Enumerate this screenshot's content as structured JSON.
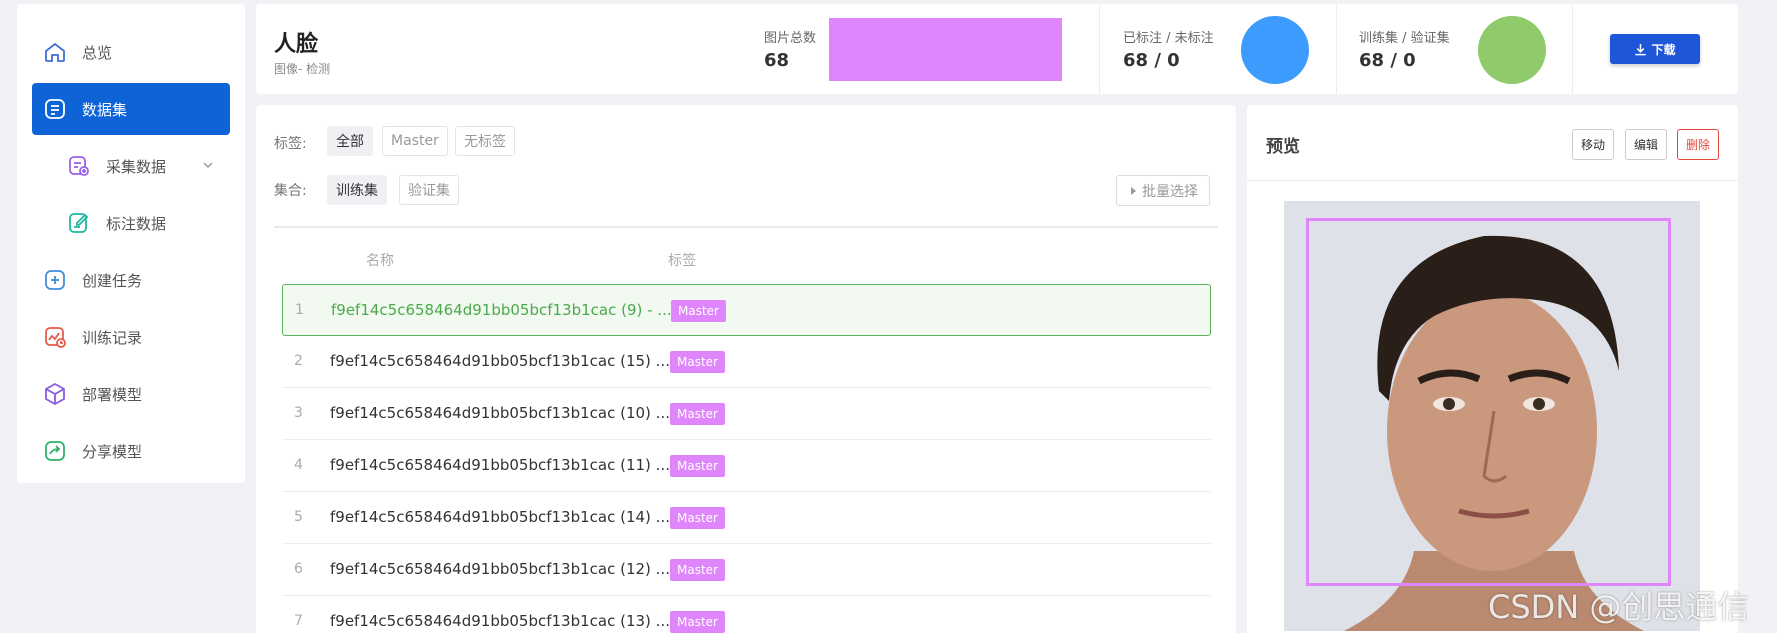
{
  "sidebar": {
    "items": [
      {
        "label": "总览",
        "icon": "home-icon"
      },
      {
        "label": "数据集",
        "icon": "dataset-icon",
        "active": true
      },
      {
        "label": "采集数据",
        "icon": "collect-data-icon",
        "sub": true
      },
      {
        "label": "标注数据",
        "icon": "annotate-data-icon",
        "sub": true
      },
      {
        "label": "创建任务",
        "icon": "plus-square-icon"
      },
      {
        "label": "训练记录",
        "icon": "training-record-icon"
      },
      {
        "label": "部署模型",
        "icon": "cube-icon"
      },
      {
        "label": "分享模型",
        "icon": "share-icon"
      }
    ]
  },
  "header": {
    "title": "人脸",
    "subtitle": "图像- 检测",
    "stat_images_label": "图片总数",
    "stat_images_value": "68",
    "stat_labeled_label": "已标注 / 未标注",
    "stat_labeled_value": "68 / 0",
    "stat_split_label": "训练集 / 验证集",
    "stat_split_value": "68 / 0",
    "download_label": "下载",
    "colors": {
      "pink": "#e086fc",
      "blue": "#3d9bfd",
      "green": "#8fca6b",
      "accent": "#1e56d8"
    }
  },
  "filters": {
    "tag_label": "标签:",
    "tag_options": [
      "全部",
      "Master",
      "无标签"
    ],
    "set_label": "集合:",
    "set_options": [
      "训练集",
      "验证集"
    ],
    "batch_select": "批量选择"
  },
  "table": {
    "col_name": "名称",
    "col_tag": "标签",
    "rows": [
      {
        "num": "1",
        "name": "f9ef14c5c658464d91bb05bcf13b1cac (9) - ...",
        "tag": "Master"
      },
      {
        "num": "2",
        "name": "f9ef14c5c658464d91bb05bcf13b1cac (15) ...",
        "tag": "Master"
      },
      {
        "num": "3",
        "name": "f9ef14c5c658464d91bb05bcf13b1cac (10) ...",
        "tag": "Master"
      },
      {
        "num": "4",
        "name": "f9ef14c5c658464d91bb05bcf13b1cac (11) ...",
        "tag": "Master"
      },
      {
        "num": "5",
        "name": "f9ef14c5c658464d91bb05bcf13b1cac (14) ...",
        "tag": "Master"
      },
      {
        "num": "6",
        "name": "f9ef14c5c658464d91bb05bcf13b1cac (12) ...",
        "tag": "Master"
      },
      {
        "num": "7",
        "name": "f9ef14c5c658464d91bb05bcf13b1cac (13) ...",
        "tag": "Master"
      }
    ]
  },
  "preview": {
    "title": "预览",
    "move": "移动",
    "edit": "编辑",
    "delete": "删除"
  },
  "watermark": "CSDN @创思通信"
}
